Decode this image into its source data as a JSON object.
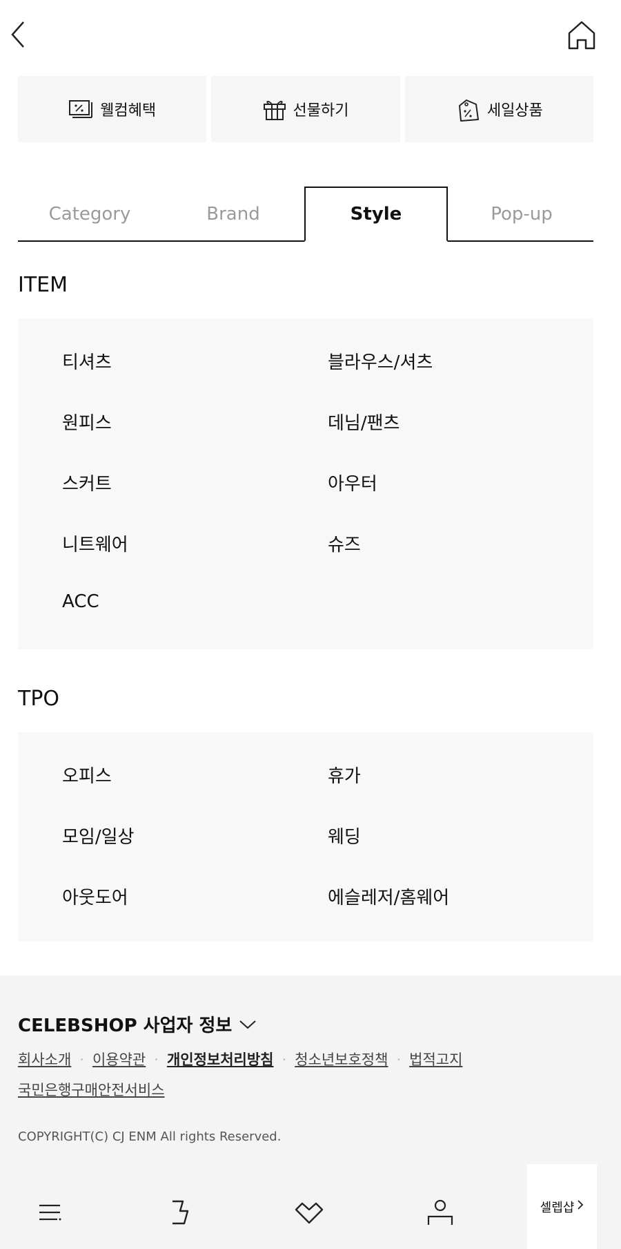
{
  "quick_links": [
    {
      "label": "웰컴혜택",
      "icon": "welcome-coupon-icon"
    },
    {
      "label": "선물하기",
      "icon": "gift-icon"
    },
    {
      "label": "세일상품",
      "icon": "sale-tag-icon"
    }
  ],
  "tabs": [
    {
      "label": "Category",
      "active": false
    },
    {
      "label": "Brand",
      "active": false
    },
    {
      "label": "Style",
      "active": true
    },
    {
      "label": "Pop-up",
      "active": false
    }
  ],
  "item_section": {
    "title": "ITEM",
    "items": [
      "티셔츠",
      "블라우스/셔츠",
      "원피스",
      "데님/팬츠",
      "스커트",
      "아우터",
      "니트웨어",
      "슈즈",
      "ACC"
    ]
  },
  "tpo_section": {
    "title": "TPO",
    "items": [
      "오피스",
      "휴가",
      "모임/일상",
      "웨딩",
      "아웃도어",
      "에슬레저/홈웨어"
    ]
  },
  "footer": {
    "business_info_label": "CELEBSHOP 사업자 정보",
    "links": [
      "회사소개",
      "이용약관",
      "개인정보처리방침",
      "청소년보호정책",
      "법적고지",
      "국민은행구매안전서비스"
    ],
    "copyright": "COPYRIGHT(C) CJ ENM All rights Reserved."
  },
  "bottom_nav": {
    "icons": [
      "menu-icon",
      "brand-icon",
      "wishlist-icon",
      "mypage-icon"
    ],
    "celebshop_label": "셀렙샵"
  },
  "colors": {
    "text": "#111111",
    "muted": "#9a9a9a",
    "panel": "#f8f8f8",
    "footer": "#f4f4f4"
  }
}
